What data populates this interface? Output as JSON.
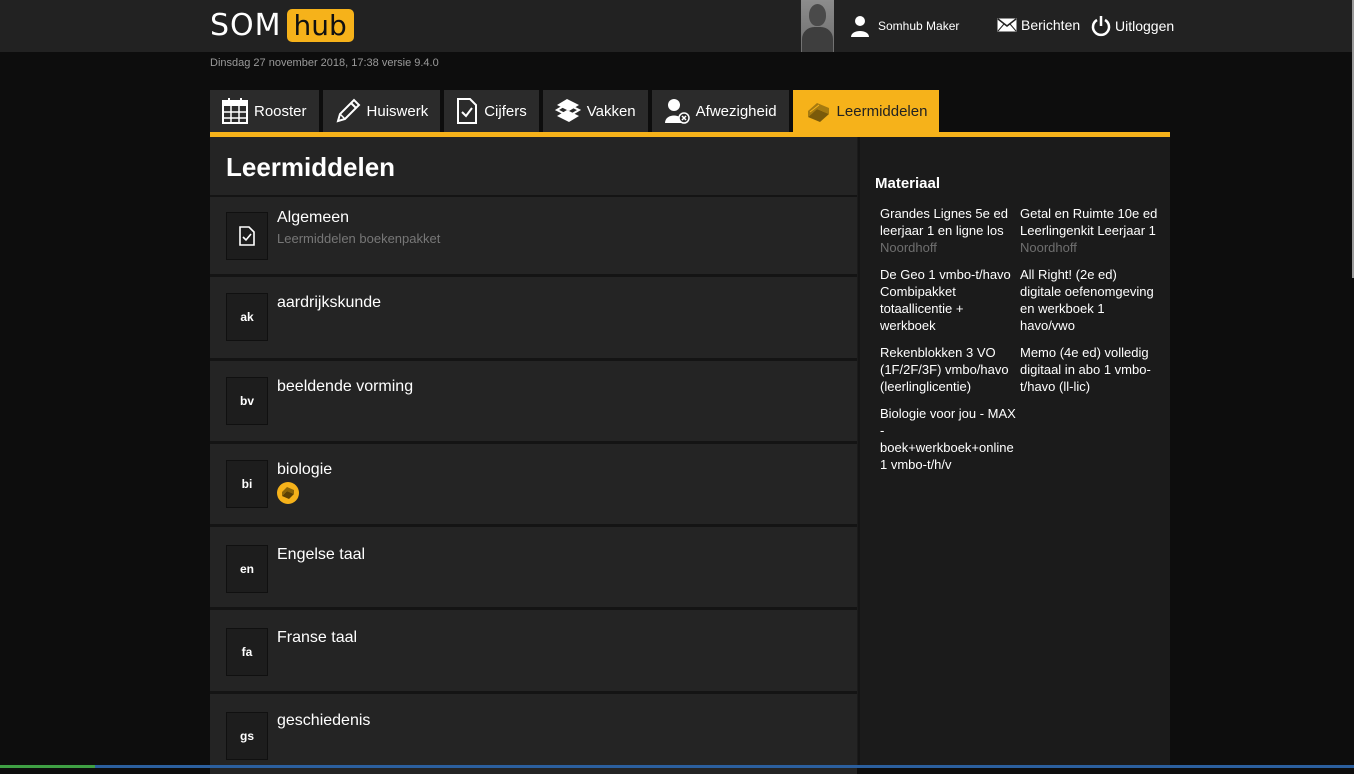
{
  "header": {
    "logo_som": "SOM",
    "logo_hub": "hub",
    "user_name": "Somhub Maker",
    "messages_label": "Berichten",
    "logout_label": "Uitloggen"
  },
  "datebar": "Dinsdag 27 november 2018, 17:38 versie 9.4.0",
  "tabs": [
    {
      "label": "Rooster",
      "icon": "calendar-icon"
    },
    {
      "label": "Huiswerk",
      "icon": "pencil-icon"
    },
    {
      "label": "Cijfers",
      "icon": "grade-sheet-icon"
    },
    {
      "label": "Vakken",
      "icon": "books-icon"
    },
    {
      "label": "Afwezigheid",
      "icon": "absence-icon"
    },
    {
      "label": "Leermiddelen",
      "icon": "book-icon",
      "active": true
    }
  ],
  "page_title": "Leermiddelen",
  "subjects": [
    {
      "code": "",
      "name": "Algemeen",
      "sub": "Leermiddelen boekenpakket"
    },
    {
      "code": "ak",
      "name": "aardrijkskunde"
    },
    {
      "code": "bv",
      "name": "beeldende vorming"
    },
    {
      "code": "bi",
      "name": "biologie"
    },
    {
      "code": "en",
      "name": "Engelse taal"
    },
    {
      "code": "fa",
      "name": "Franse taal"
    },
    {
      "code": "gs",
      "name": "geschiedenis"
    }
  ],
  "materials": {
    "title": "Materiaal",
    "items": [
      {
        "title": "Grandes Lignes 5e ed leerjaar 1 en ligne los",
        "publisher": "Noordhoff"
      },
      {
        "title": "Getal en Ruimte 10e ed Leerlingenkit Leerjaar 1",
        "publisher": "Noordhoff"
      },
      {
        "title": "De Geo 1 vmbo-t/havo Combipakket totaallicentie + werkboek",
        "publisher": ""
      },
      {
        "title": "All Right! (2e ed) digitale oefenomgeving en werkboek 1 havo/vwo",
        "publisher": ""
      },
      {
        "title": "Rekenblokken 3 VO (1F/2F/3F) vmbo/havo (leerlinglicentie)",
        "publisher": ""
      },
      {
        "title": "Memo (4e ed) volledig digitaal in abo 1 vmbo-t/havo (ll-lic)",
        "publisher": ""
      },
      {
        "title": "Biologie voor jou - MAX - boek+werkboek+online 1 vmbo-t/h/v",
        "publisher": ""
      }
    ]
  },
  "colors": {
    "accent": "#f6b21a",
    "background": "#0d0d0d",
    "panel": "#242424"
  }
}
